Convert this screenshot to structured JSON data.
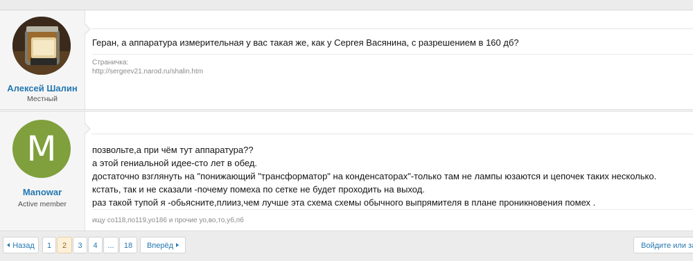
{
  "posts": [
    {
      "username": "Алексей Шалин",
      "user_title": "Местный",
      "message_lines": [
        "Геран, а аппаратура измерительная у вас такая же, как у Сергея Васянина, с разрешением в 160 дб?"
      ],
      "signature_lines": [
        "Страничка:",
        "http://sergeev21.narod.ru/shalin.htm"
      ]
    },
    {
      "username": "Manowar",
      "user_title": "Active member",
      "avatar_letter": "M",
      "message_lines": [
        "позвольте,а при чём тут аппаратура??",
        "а этой гениальной идее-сто лет в обед.",
        "достаточно взглянуть на \"понижающий \"трансформатор\" на конденсаторах\"-только там не лампы юзаются и цепочек таких несколько.",
        "кстать, так и не сказали -почему помеха по сетке не будет проходить на выход.",
        "раз такой тупой я -обьясните,плииз,чем лучше эта схема схемы обычного выпрямителя в плане проникновения помех ."
      ],
      "signature_lines": [
        "ищу со118,по119,уо186 и прочие уо,во,то,уб,пб"
      ]
    }
  ],
  "pagination": {
    "prev_label": "Назад",
    "pages": [
      "1",
      "2",
      "3",
      "4"
    ],
    "ellipsis": "...",
    "last_page": "18",
    "current_page": "2",
    "next_label": "Вперёд"
  },
  "signin_label": "Войдите или зарегистрируйтесь",
  "colors": {
    "accent": "#2577b1",
    "current_page_bg": "#fdf0d8",
    "avatar_manowar": "#7fa03c"
  }
}
